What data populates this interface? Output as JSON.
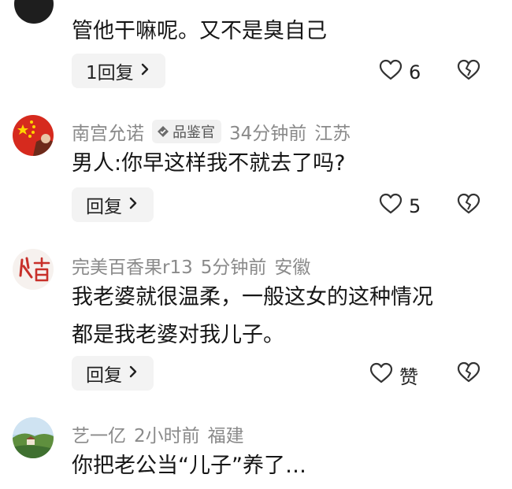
{
  "comments": [
    {
      "content": "管他干嘛呢。又不是臭自己",
      "reply_label": "1回复",
      "likes": "6"
    },
    {
      "author": "南宫允诺",
      "badge": "品鉴官",
      "time": "34分钟前",
      "location": "江苏",
      "content": "男人:你早这样我不就去了吗?",
      "reply_label": "回复",
      "likes": "5"
    },
    {
      "author": "完美百香果r13",
      "time": "5分钟前",
      "location": "安徽",
      "content_lines": [
        "我老婆就很温柔，一般这女的这种情况",
        "都是我老婆对我儿子。"
      ],
      "reply_label": "回复",
      "likes": "赞"
    },
    {
      "author": "艺一亿",
      "time": "2小时前",
      "location": "福建",
      "content": "你把老公当“儿子”养了…"
    }
  ],
  "colors": {
    "meta_text": "#8a8a8a",
    "reply_bg": "#f3f3f3",
    "badge_bg": "#f1f1f1"
  }
}
